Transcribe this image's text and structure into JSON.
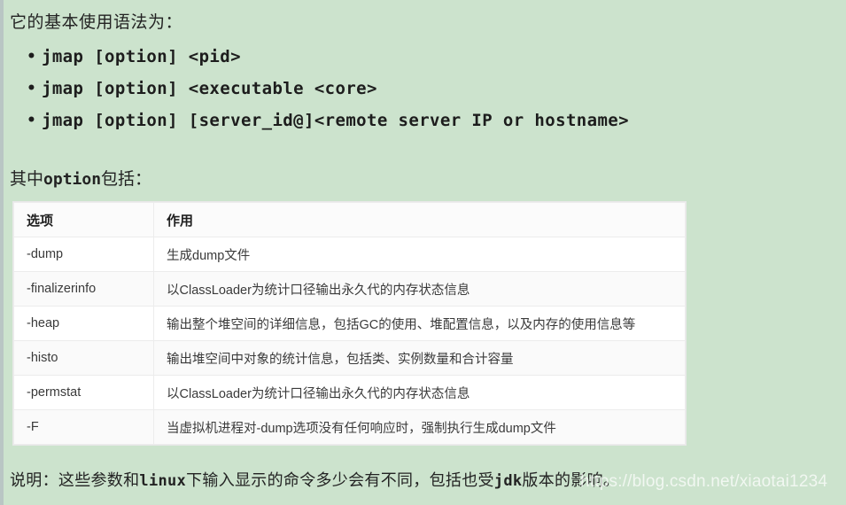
{
  "page": {
    "background_color": "#cce3cd",
    "intro_text": "它的基本使用语法为：",
    "section_label_prefix": "其中",
    "section_label_mono": "option",
    "section_label_suffix": "包括："
  },
  "command_list": [
    {
      "bullet": "•",
      "text": "jmap [option] <pid>"
    },
    {
      "bullet": "•",
      "text": "jmap [option] <executable <core>"
    },
    {
      "bullet": "•",
      "text": "jmap [option] [server_id@]<remote server IP or hostname>"
    }
  ],
  "table": {
    "headers": [
      "选项",
      "作用"
    ],
    "rows": [
      {
        "option": "-dump",
        "effect": "生成dump文件"
      },
      {
        "option": "-finalizerinfo",
        "effect": "以ClassLoader为统计口径输出永久代的内存状态信息"
      },
      {
        "option": "-heap",
        "effect": "输出整个堆空间的详细信息，包括GC的使用、堆配置信息，以及内存的使用信息等"
      },
      {
        "option": "-histo",
        "effect": "输出堆空间中对象的统计信息，包括类、实例数量和合计容量"
      },
      {
        "option": "-permstat",
        "effect": "以ClassLoader为统计口径输出永久代的内存状态信息"
      },
      {
        "option": "-F",
        "effect": "当虚拟机进程对-dump选项没有任何响应时，强制执行生成dump文件"
      }
    ]
  },
  "footnote": {
    "prefix": "说明：这些参数和",
    "mono": "linux",
    "middle": "下输入显示的命令多少会有不同，包括也受",
    "mono2": "jdk",
    "suffix": "版本的影响。"
  },
  "watermark": {
    "text": "https://blog.csdn.net/xiaotai1234"
  }
}
